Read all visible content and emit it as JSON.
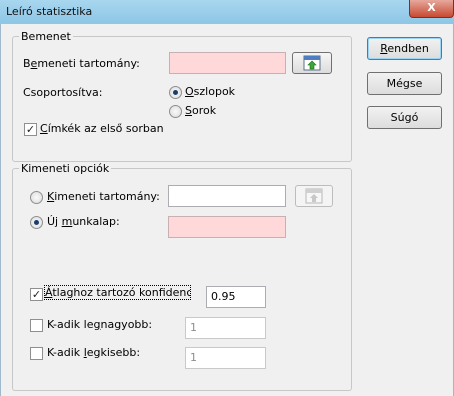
{
  "window": {
    "title": "Leíró statisztika",
    "close_glyph": "X"
  },
  "input_group": {
    "legend": "Bemenet",
    "range_label_pre": "B",
    "range_label_u": "e",
    "range_label_post": "meneti tartomány:",
    "range_value": "",
    "grouped_label": "Csoportosítva:",
    "columns_u": "O",
    "columns_rest": "szlopok",
    "rows_u": "S",
    "rows_rest": "orok",
    "grouped_selected": "columns",
    "labels_u": "C",
    "labels_rest": "ímkék az első sorban",
    "labels_checked": true
  },
  "output_group": {
    "legend": "Kimeneti opciók",
    "output_range_u": "K",
    "output_range_rest": "imeneti tartomány:",
    "output_range_value": "",
    "new_sheet_pre": "Új ",
    "new_sheet_u": "m",
    "new_sheet_post": "unkalap:",
    "new_sheet_value": "",
    "selected": "new_sheet",
    "confidence_u": "Á",
    "confidence_rest": "tlaghoz tartozó konfidencia",
    "confidence_checked": true,
    "confidence_value": "0.95",
    "kth_largest_pre": "K-adik le",
    "kth_largest_u": "g",
    "kth_largest_post": "nagyobb:",
    "kth_largest_checked": false,
    "kth_largest_value": "1",
    "kth_smallest_pre": "K-adik ",
    "kth_smallest_u": "l",
    "kth_smallest_post": "egkisebb:",
    "kth_smallest_checked": false,
    "kth_smallest_value": "1"
  },
  "buttons": {
    "ok_u": "R",
    "ok_rest": "endben",
    "cancel": "Mégse",
    "help": "Súgó"
  },
  "colors": {
    "required_field": "#ffd9d9",
    "titlebar": "#a8d6ef",
    "close": "#c84a32"
  }
}
